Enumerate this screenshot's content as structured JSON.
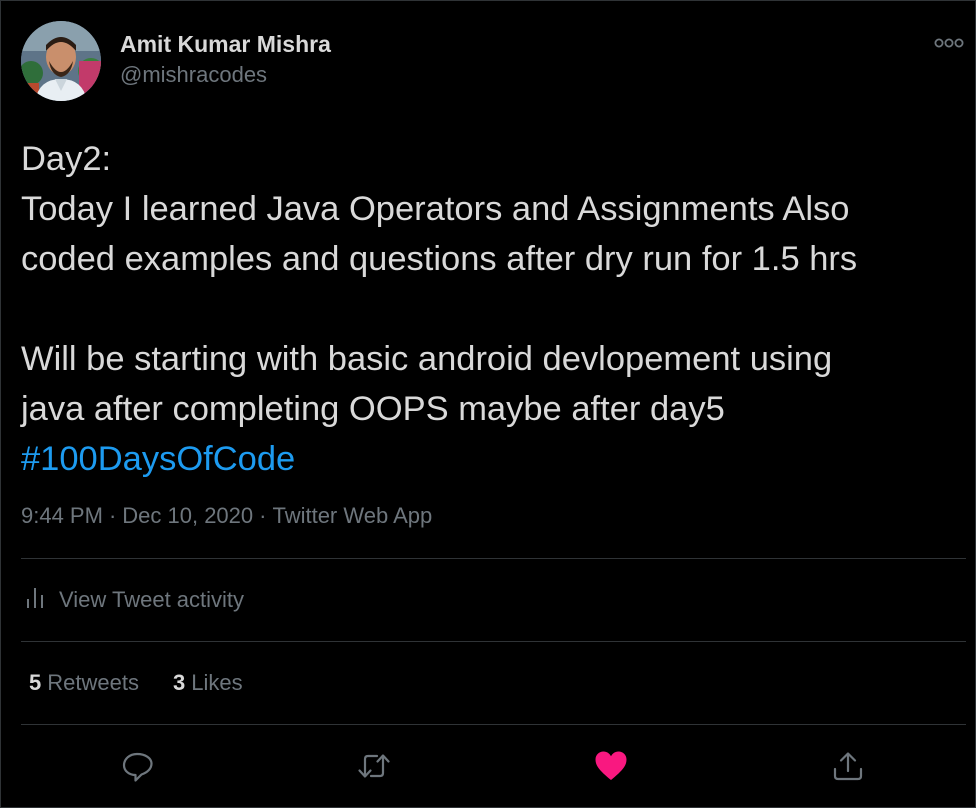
{
  "author": {
    "name": "Amit Kumar Mishra",
    "handle": "@mishracodes"
  },
  "tweet": {
    "lines": [
      "Day2:",
      "Today I learned Java Operators and Assignments Also",
      "coded examples and questions after dry run for 1.5 hrs",
      "",
      "Will be starting with basic android devlopement using",
      "java after completing OOPS maybe after day5"
    ],
    "hashtag": "#100DaysOfCode"
  },
  "meta": {
    "time": "9:44 PM",
    "date": "Dec 10, 2020",
    "source": "Twitter Web App",
    "separator": "·"
  },
  "activity": {
    "label": "View Tweet activity"
  },
  "stats": {
    "retweets_count": "5",
    "retweets_label": "Retweets",
    "likes_count": "3",
    "likes_label": "Likes"
  },
  "actions": {
    "reply_icon": "reply-icon",
    "retweet_icon": "retweet-icon",
    "like_icon": "heart-filled-icon",
    "share_icon": "share-icon"
  },
  "colors": {
    "background": "#000000",
    "text": "#d9d9d9",
    "secondary": "#6e767d",
    "link": "#1d9bf0",
    "like": "#f91880",
    "divider": "#2f3336"
  }
}
